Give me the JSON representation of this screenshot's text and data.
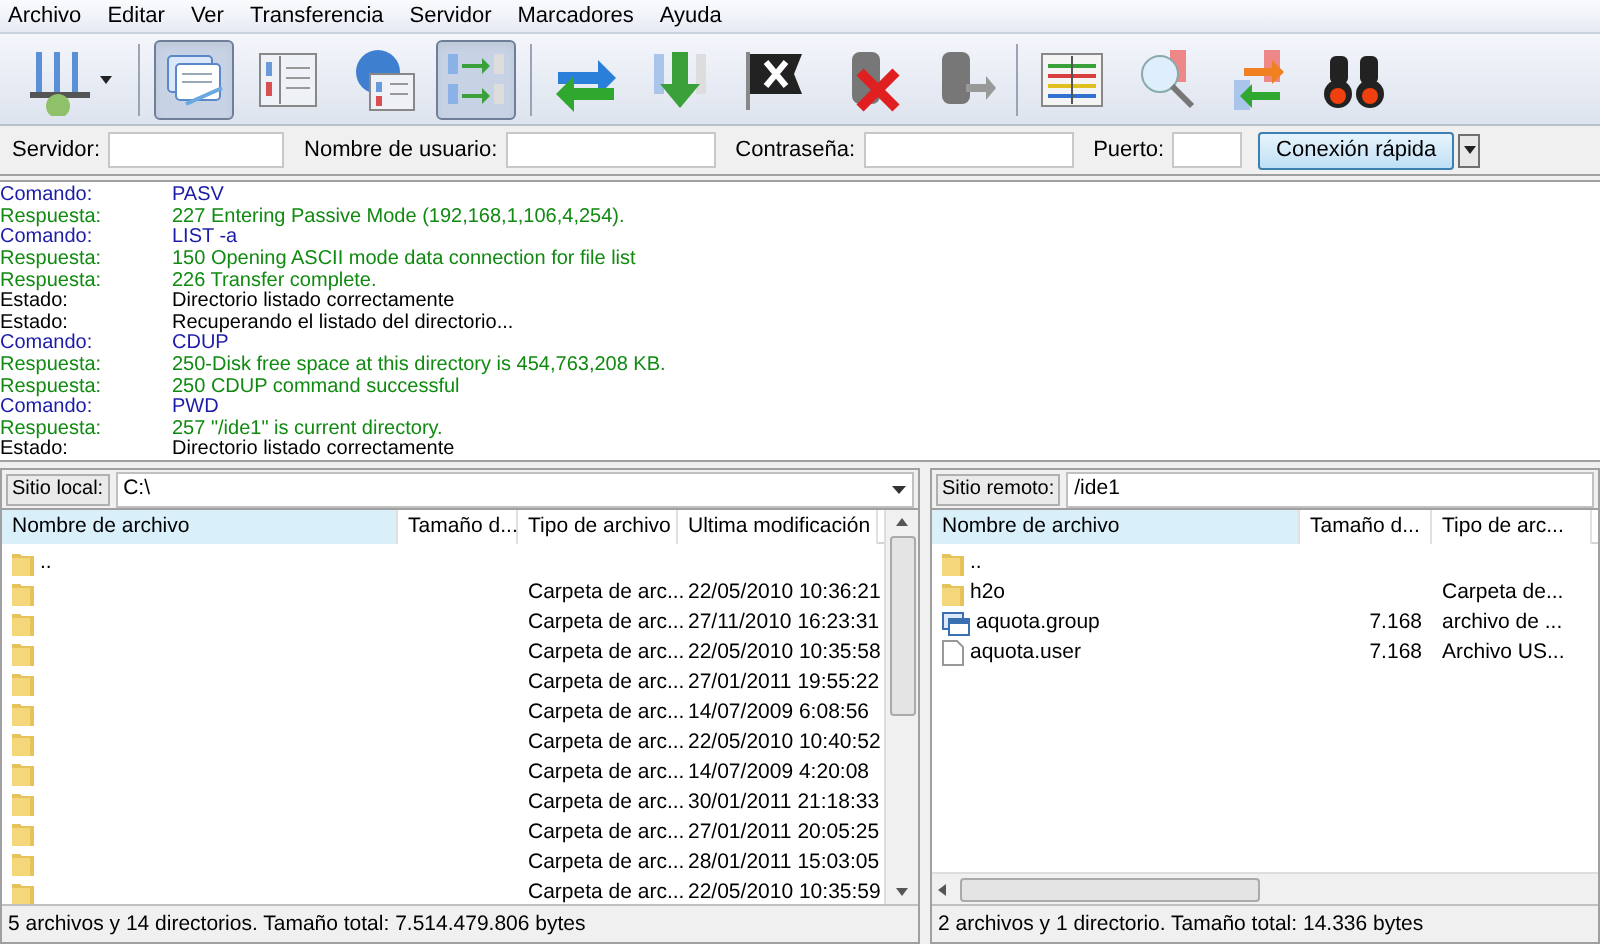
{
  "menu": [
    "Archivo",
    "Editar",
    "Ver",
    "Transferencia",
    "Servidor",
    "Marcadores",
    "Ayuda"
  ],
  "toolbar": [
    {
      "pressed": false
    },
    {
      "pressed": true
    },
    {
      "pressed": false
    },
    {
      "pressed": false
    },
    {
      "pressed": true
    },
    {
      "pressed": false
    },
    {
      "pressed": false
    },
    {
      "pressed": false
    },
    {
      "pressed": false
    },
    {
      "pressed": false
    },
    {
      "pressed": false
    },
    {
      "pressed": false
    },
    {
      "pressed": false
    },
    {
      "pressed": false
    }
  ],
  "quickconnect": {
    "fields": [
      {
        "label": "Servidor:"
      },
      {
        "label": "Nombre de usuario:"
      },
      {
        "label": "Contraseña:"
      },
      {
        "label": "Puerto:"
      }
    ],
    "button": "Conexión rápida"
  },
  "log": [
    {
      "kind": "command",
      "label": "Comando:",
      "text": "PASV"
    },
    {
      "kind": "response",
      "label": "Respuesta:",
      "text": "227 Entering Passive Mode (192,168,1,106,4,254)."
    },
    {
      "kind": "command",
      "label": "Comando:",
      "text": "LIST -a"
    },
    {
      "kind": "response",
      "label": "Respuesta:",
      "text": "150 Opening ASCII mode data connection for file list"
    },
    {
      "kind": "response",
      "label": "Respuesta:",
      "text": "226 Transfer complete."
    },
    {
      "kind": "status",
      "label": "Estado:",
      "text": "Directorio listado correctamente"
    },
    {
      "kind": "status",
      "label": "Estado:",
      "text": "Recuperando el listado del directorio..."
    },
    {
      "kind": "command",
      "label": "Comando:",
      "text": "CDUP"
    },
    {
      "kind": "response",
      "label": "Respuesta:",
      "text": "250-Disk free space at this directory is 454,763,208 KB."
    },
    {
      "kind": "response",
      "label": "Respuesta:",
      "text": "250 CDUP command successful"
    },
    {
      "kind": "command",
      "label": "Comando:",
      "text": "PWD"
    },
    {
      "kind": "response",
      "label": "Respuesta:",
      "text": "257 \"/ide1\" is current directory."
    },
    {
      "kind": "status",
      "label": "Estado:",
      "text": "Directorio listado correctamente"
    }
  ],
  "local": {
    "site_label": "Sitio local:",
    "path": "C:\\",
    "columns": [
      "Nombre de archivo",
      "Tamaño d...",
      "Tipo de archivo",
      "Ultima modificación"
    ],
    "rows": [
      {
        "kind": "folder",
        "name": ".."
      },
      {
        "kind": "folder",
        "type": "Carpeta de arc...",
        "modified": "22/05/2010 10:36:21"
      },
      {
        "kind": "folder",
        "type": "Carpeta de arc...",
        "modified": "27/11/2010 16:23:31"
      },
      {
        "kind": "folder",
        "type": "Carpeta de arc...",
        "modified": "22/05/2010 10:35:58"
      },
      {
        "kind": "folder",
        "type": "Carpeta de arc...",
        "modified": "27/01/2011 19:55:22"
      },
      {
        "kind": "folder",
        "type": "Carpeta de arc...",
        "modified": "14/07/2009 6:08:56"
      },
      {
        "kind": "folder",
        "type": "Carpeta de arc...",
        "modified": "22/05/2010 10:40:52"
      },
      {
        "kind": "folder",
        "type": "Carpeta de arc...",
        "modified": "14/07/2009 4:20:08"
      },
      {
        "kind": "folder",
        "type": "Carpeta de arc...",
        "modified": "30/01/2011 21:18:33"
      },
      {
        "kind": "folder",
        "type": "Carpeta de arc...",
        "modified": "27/01/2011 20:05:25"
      },
      {
        "kind": "folder",
        "type": "Carpeta de arc...",
        "modified": "28/01/2011 15:03:05"
      },
      {
        "kind": "folder",
        "type": "Carpeta de arc...",
        "modified": "22/05/2010 10:35:59"
      }
    ],
    "status": "5 archivos y 14 directorios. Tamaño total: 7.514.479.806 bytes"
  },
  "remote": {
    "site_label": "Sitio remoto:",
    "path": "/ide1",
    "columns": [
      "Nombre de archivo",
      "Tamaño d...",
      "Tipo de arc..."
    ],
    "rows": [
      {
        "kind": "folder",
        "name": ".."
      },
      {
        "kind": "folder",
        "name": "h2o",
        "type": "Carpeta de..."
      },
      {
        "kind": "app",
        "name": "aquota.group",
        "size": "7.168",
        "type": "archivo de ..."
      },
      {
        "kind": "file",
        "name": "aquota.user",
        "size": "7.168",
        "type": "Archivo US..."
      }
    ],
    "status": "2 archivos y 1 directorio. Tamaño total: 14.336 bytes"
  }
}
